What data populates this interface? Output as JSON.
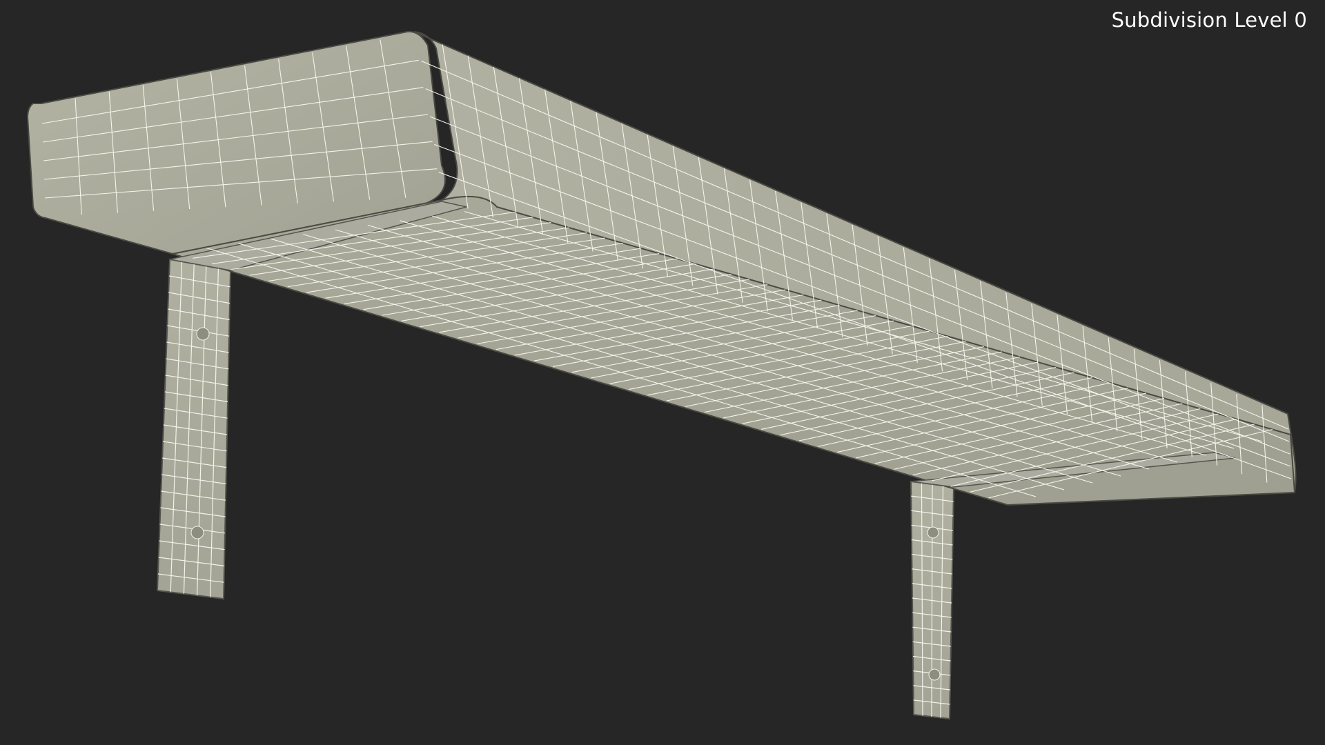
{
  "viewport": {
    "label": "Subdivision Level 0",
    "background_color": "#262626",
    "mesh_fill_color": "#a8a898",
    "wire_color": "#f4f4ec",
    "edge_color": "#4a4a44"
  },
  "scene": {
    "object": "wall shelf with two L-shaped brackets",
    "display_mode": "wireframe-on-shaded"
  }
}
